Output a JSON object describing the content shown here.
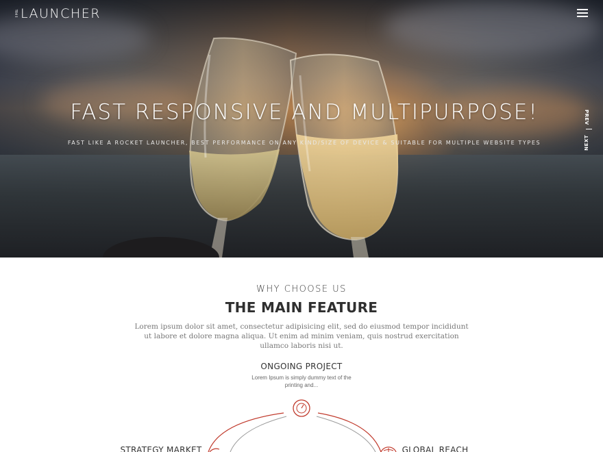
{
  "brand": {
    "logo_prefix": "THE",
    "logo_main": "LAUNCHER"
  },
  "hero": {
    "title": "FAST RESPONSIVE AND MULTIPURPOSE!",
    "subtitle": "FAST LIKE A ROCKET LAUNCHER, BEST PERFORMANCE ON ANY KIND/SIZE OF DEVICE & SUITABLE FOR MULTIPLE WEBSITE TYPES",
    "nav": {
      "prev": "PREV",
      "next": "NEXT"
    }
  },
  "features": {
    "eyebrow": "WHY CHOOSE US",
    "title": "THE MAIN FEATURE",
    "description": "Lorem ipsum dolor sit amet, consectetur adipisicing elit, sed do eiusmod tempor incididunt ut labore et dolore magna aliqua. Ut enim ad minim veniam, quis nostrud exercitation ullamco laboris nisi ut.",
    "items": [
      {
        "title": "ONGOING PROJECT",
        "description": "Lorem Ipsum is simply dummy text of the printing and..."
      },
      {
        "title": "STRATEGY MARKET"
      },
      {
        "title": "GLOBAL REACH"
      }
    ]
  },
  "colors": {
    "accent": "#c0392b",
    "arc_gray": "#9a9a9a"
  },
  "icons": [
    "menu-icon",
    "speedometer-icon",
    "strategy-icon",
    "globe-icon"
  ]
}
